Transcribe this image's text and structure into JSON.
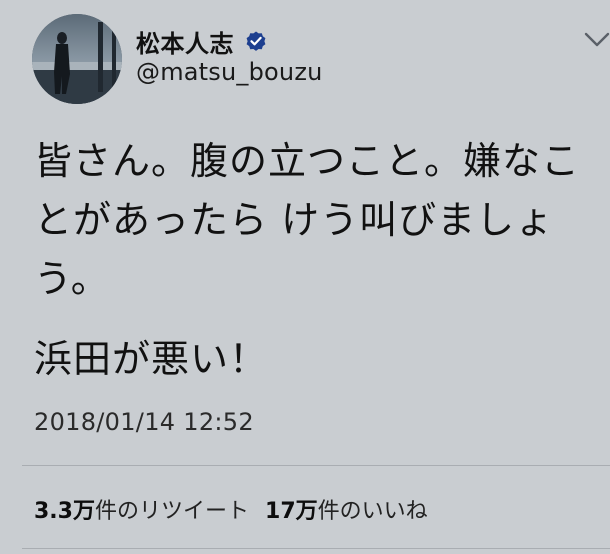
{
  "user": {
    "display_name": "松本人志",
    "handle": "@matsu_bouzu",
    "verified": true
  },
  "tweet": {
    "body_lines": "皆さん。腹の立つこと。嫌なこ\nとがあったら けう叫びましょ\nう。",
    "body_line_2": "浜田が悪い！",
    "timestamp": "2018/01/14 12:52"
  },
  "stats": {
    "retweets_number": "3.3",
    "retweets_unit": "万",
    "retweets_label": "件のリツイート",
    "likes_number": "17",
    "likes_unit": "万",
    "likes_label": "件のいいね"
  },
  "icons": {
    "avatar": "profile-photo",
    "verified": "verified-badge-icon",
    "menu": "chevron-down-icon"
  },
  "colors": {
    "background": "#c9cdd1",
    "verified_blue": "#1d3f8f",
    "text": "#111111"
  }
}
